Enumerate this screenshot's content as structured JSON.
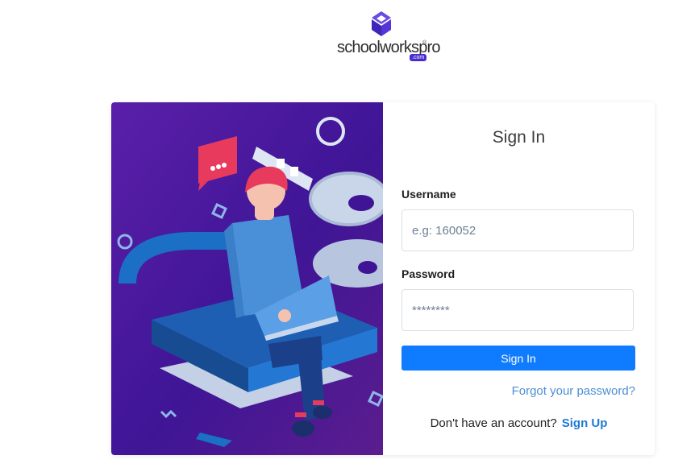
{
  "brand": {
    "name": "schoolworkspro",
    "registered_mark": "®",
    "domain_badge": ".com"
  },
  "form": {
    "title": "Sign In",
    "username_label": "Username",
    "username_placeholder": "e.g: 160052",
    "password_label": "Password",
    "password_placeholder": "********",
    "submit_label": "Sign In",
    "forgot_link": "Forgot your password?",
    "no_account_text": "Don't have an account?",
    "signup_link": "Sign Up"
  },
  "colors": {
    "primary": "#0f7bff",
    "brand_purple": "#4a2bcf",
    "hero_bg": "#4a1a9e"
  }
}
